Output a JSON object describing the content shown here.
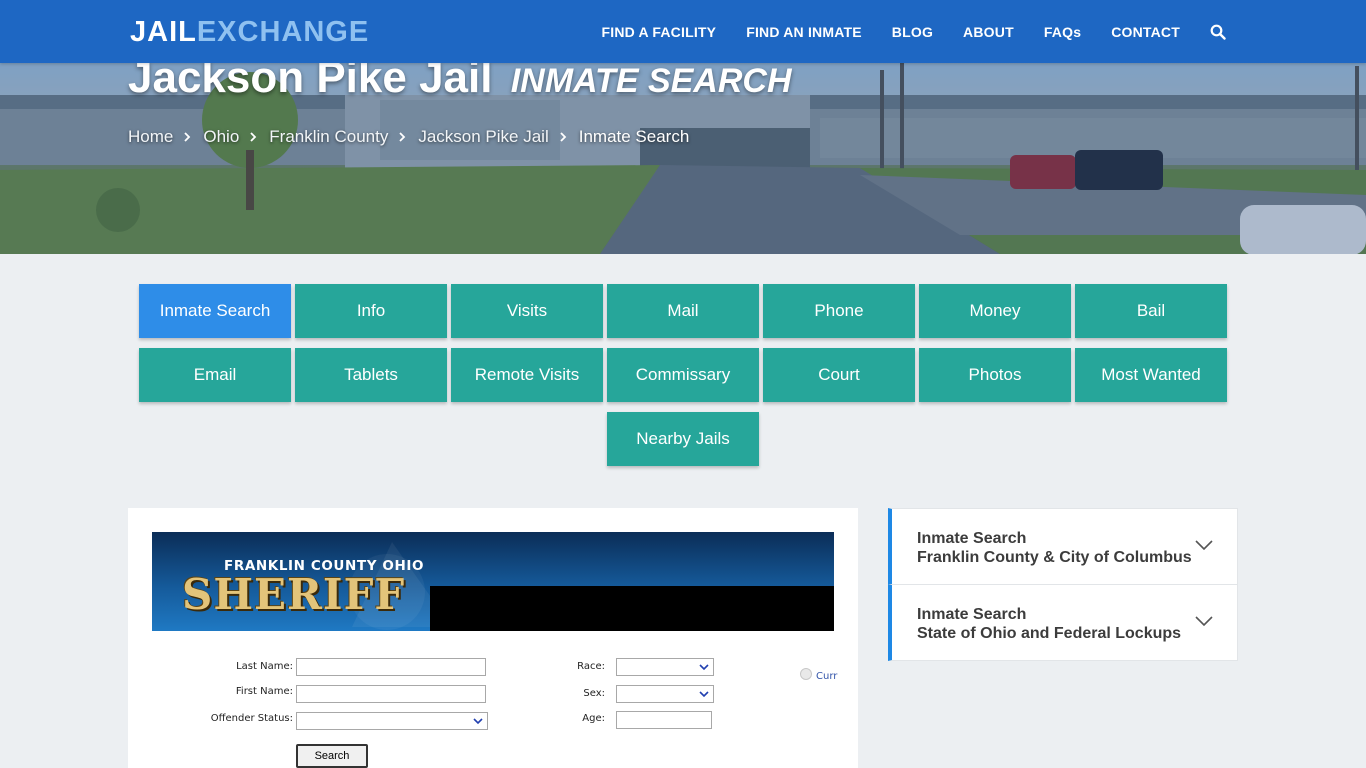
{
  "logo": {
    "part1": "JAIL",
    "part2": "EXCHANGE"
  },
  "nav": {
    "items": [
      "FIND A FACILITY",
      "FIND AN INMATE",
      "BLOG",
      "ABOUT",
      "FAQs",
      "CONTACT"
    ],
    "search_icon": "search-icon"
  },
  "hero": {
    "title": "Jackson Pike Jail",
    "subtitle": "INMATE SEARCH",
    "breadcrumb": [
      "Home",
      "Ohio",
      "Franklin County",
      "Jackson Pike Jail",
      "Inmate Search"
    ]
  },
  "tiles": {
    "row1": [
      "Inmate Search",
      "Info",
      "Visits",
      "Mail",
      "Phone",
      "Money",
      "Bail"
    ],
    "row2": [
      "Email",
      "Tablets",
      "Remote Visits",
      "Commissary",
      "Court",
      "Photos",
      "Most Wanted"
    ],
    "row3": [
      "Nearby Jails"
    ],
    "active": "Inmate Search"
  },
  "banner": {
    "county": "FRANKLIN COUNTY OHIO",
    "sheriff": "SHERIFF"
  },
  "form": {
    "last_name_label": "Last Name:",
    "first_name_label": "First Name:",
    "offender_status_label": "Offender Status:",
    "race_label": "Race:",
    "sex_label": "Sex:",
    "age_label": "Age:",
    "radio_label": "Curr",
    "search_button": "Search"
  },
  "sidebar": {
    "items": [
      {
        "line1": "Inmate Search",
        "line2": "Franklin County & City of Columbus"
      },
      {
        "line1": "Inmate Search",
        "line2": "State of Ohio and Federal Lockups"
      }
    ]
  },
  "colors": {
    "nav": "#1e67c3",
    "tile": "#26a69a",
    "tile_active": "#2e8de8",
    "accent": "#1e88e5"
  }
}
